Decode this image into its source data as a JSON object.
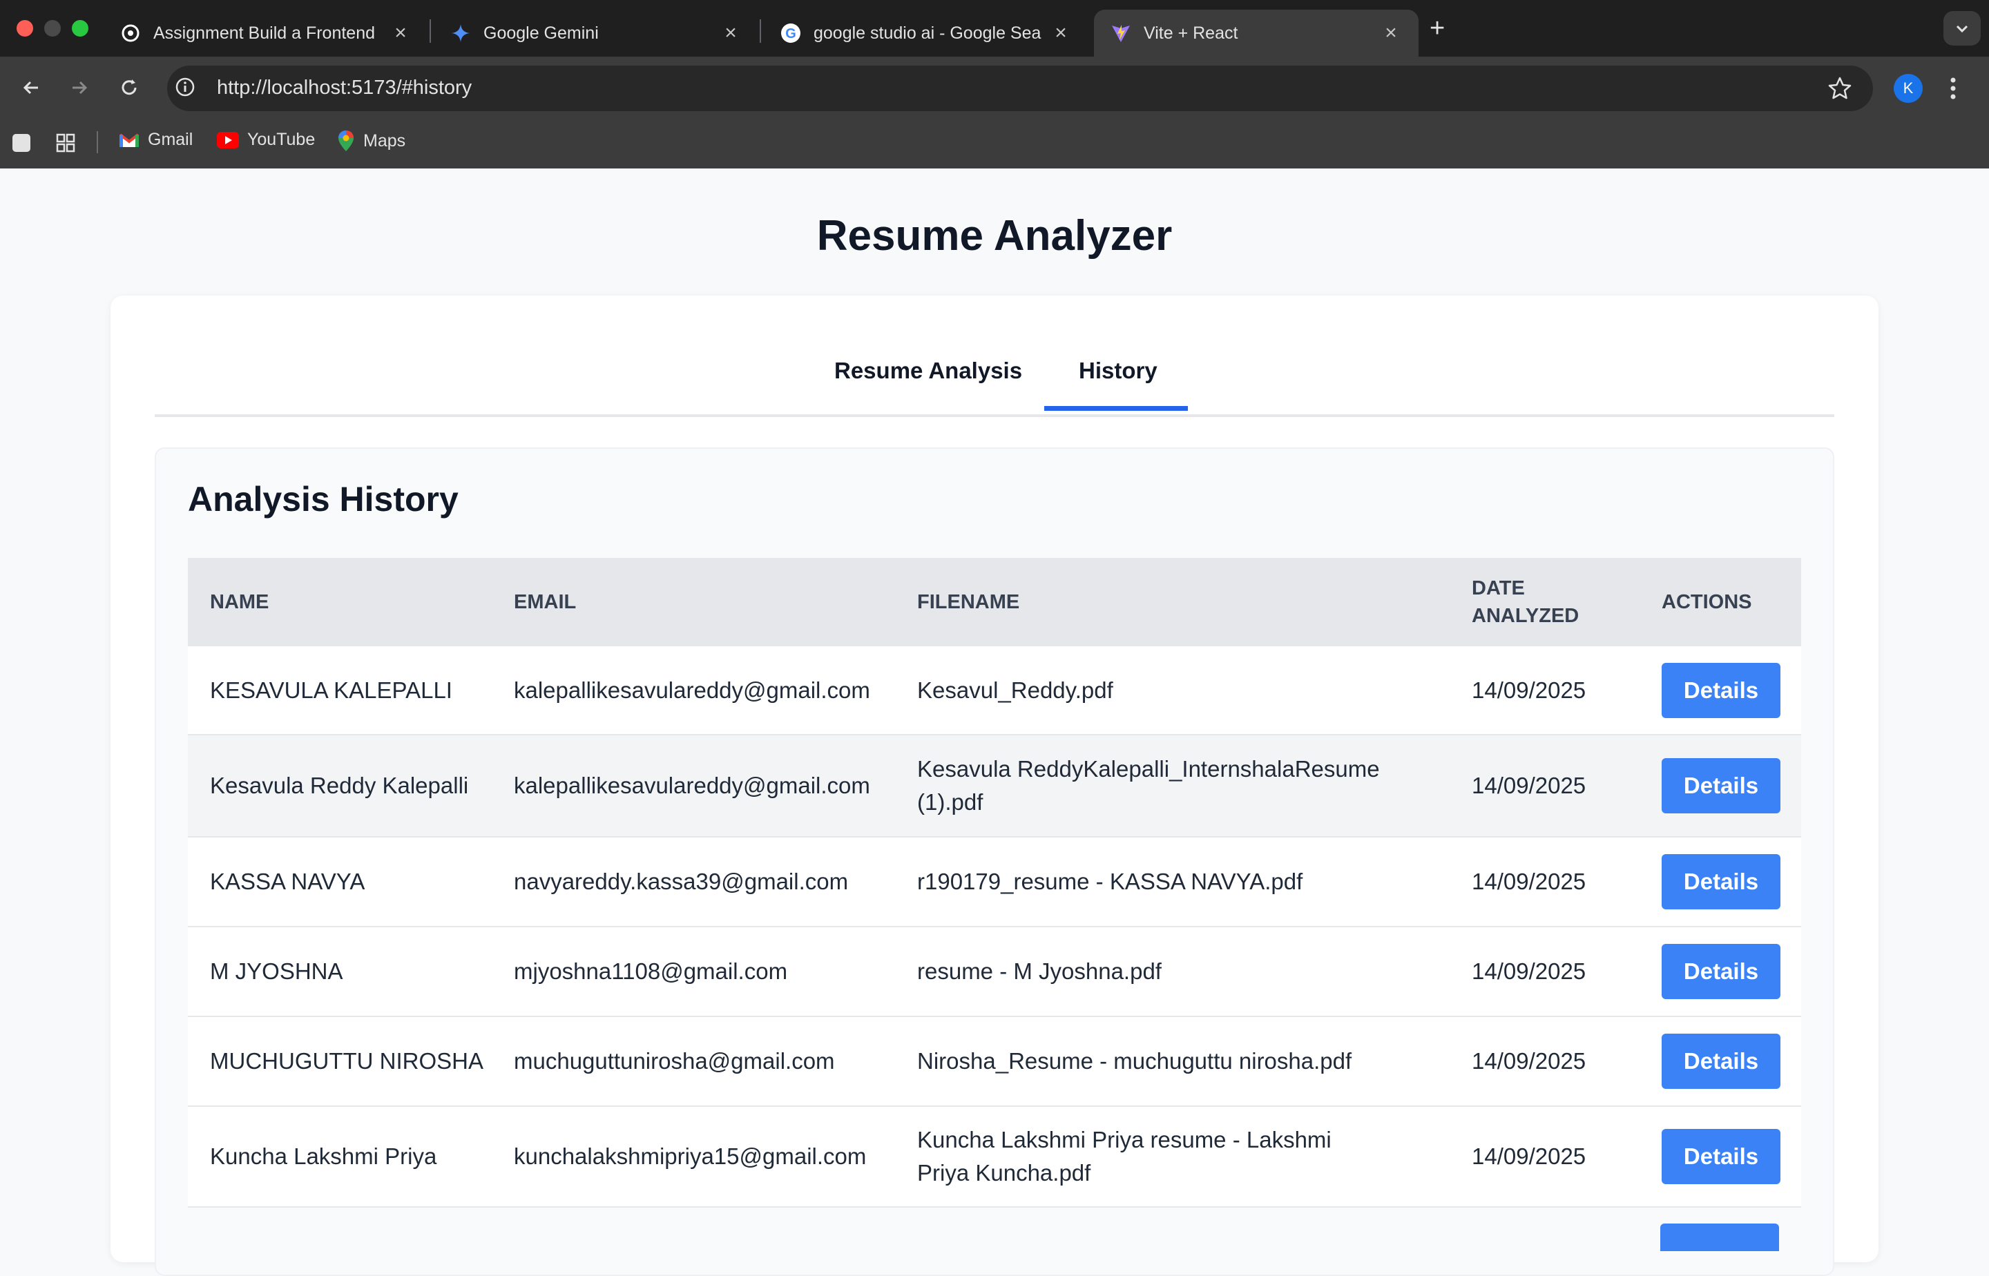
{
  "browser": {
    "tabs": [
      {
        "title": "Assignment Build a Frontend",
        "favicon": "openai-icon",
        "active": false
      },
      {
        "title": "Google Gemini",
        "favicon": "gemini-icon",
        "active": false
      },
      {
        "title": "google studio ai - Google Sea",
        "favicon": "google-icon",
        "active": false
      },
      {
        "title": "Vite + React",
        "favicon": "vite-icon",
        "active": true
      }
    ],
    "url": "http://localhost:5173/#history",
    "profile_initial": "K",
    "bookmarks": [
      {
        "label": "Gmail",
        "icon": "gmail-icon"
      },
      {
        "label": "YouTube",
        "icon": "youtube-icon"
      },
      {
        "label": "Maps",
        "icon": "maps-icon"
      }
    ]
  },
  "app": {
    "title": "Resume Analyzer",
    "tabs": [
      {
        "label": "Resume Analysis",
        "active": false
      },
      {
        "label": "History",
        "active": true
      }
    ],
    "accent_color": "#2563eb",
    "button_color": "#3b82f6"
  },
  "history": {
    "heading": "Analysis History",
    "columns": [
      "NAME",
      "EMAIL",
      "FILENAME",
      "DATE ANALYZED",
      "ACTIONS"
    ],
    "action_label": "Details",
    "rows": [
      {
        "name": "KESAVULA KALEPALLI",
        "email": "kalepallikesavulareddy@gmail.com",
        "filename": "Kesavul_Reddy.pdf",
        "date": "14/09/2025"
      },
      {
        "name": "Kesavula Reddy Kalepalli",
        "email": "kalepallikesavulareddy@gmail.com",
        "filename": "Kesavula ReddyKalepalli_InternshalaResume (1).pdf",
        "date": "14/09/2025"
      },
      {
        "name": "KASSA NAVYA",
        "email": "navyareddy.kassa39@gmail.com",
        "filename": "r190179_resume - KASSA NAVYA.pdf",
        "date": "14/09/2025"
      },
      {
        "name": "M JYOSHNA",
        "email": "mjyoshna1108@gmail.com",
        "filename": "resume - M Jyoshna.pdf",
        "date": "14/09/2025"
      },
      {
        "name": "MUCHUGUTTU NIROSHA",
        "email": "muchuguttunirosha@gmail.com",
        "filename": "Nirosha_Resume - muchuguttu nirosha.pdf",
        "date": "14/09/2025"
      },
      {
        "name": "Kuncha Lakshmi Priya",
        "email": "kunchalakshmipriya15@gmail.com",
        "filename": "Kuncha Lakshmi Priya resume - Lakshmi Priya Kuncha.pdf",
        "date": "14/09/2025"
      }
    ]
  }
}
